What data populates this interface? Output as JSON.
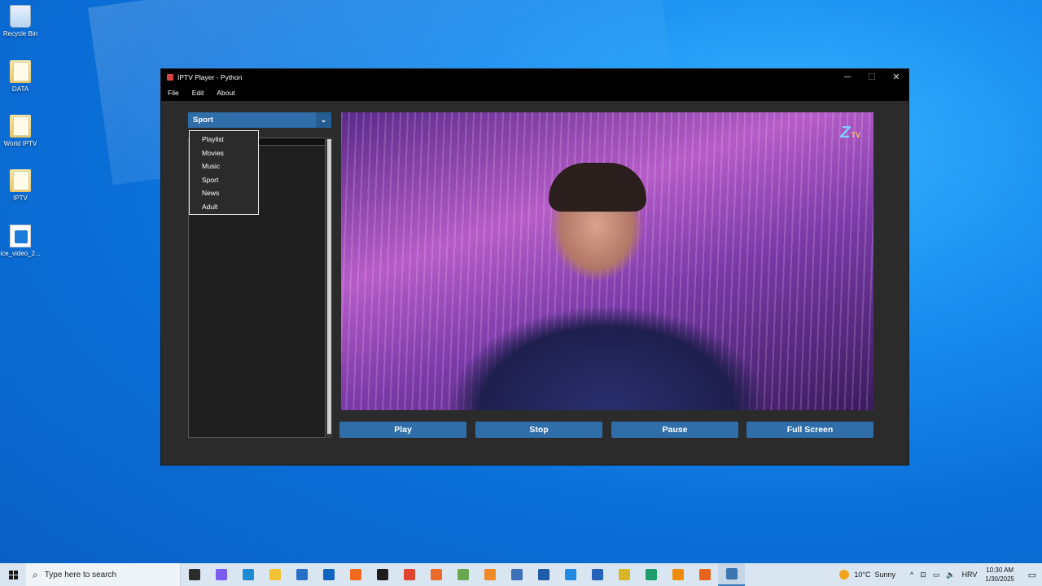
{
  "desktop": {
    "icons": [
      {
        "label": "Recycle Bin",
        "icon": "recycle-bin-icon"
      },
      {
        "label": "DATA",
        "icon": "folder-icon"
      },
      {
        "label": "World IPTV",
        "icon": "folder-icon"
      },
      {
        "label": "IPTV",
        "icon": "folder-icon"
      },
      {
        "label": "ice_video_2...",
        "icon": "video-file-icon"
      }
    ]
  },
  "window": {
    "title": "IPTV Player - Python",
    "controls": {
      "minimize": "─",
      "maximize": "☐",
      "close": "✕"
    },
    "menu": [
      "File",
      "Edit",
      "About"
    ],
    "category": {
      "selected": "Sport",
      "chevron": "⌄"
    },
    "dropdown_options": [
      "Playlist",
      "Movies",
      "Music",
      "Sport",
      "News",
      "Adult"
    ],
    "video": {
      "channel_logo": "TV",
      "logo_mark": "Z"
    },
    "buttons": {
      "play": "Play",
      "stop": "Stop",
      "pause": "Pause",
      "fullscreen": "Full Screen"
    }
  },
  "taskbar": {
    "search_placeholder": "Type here to search",
    "search_icon": "⌕",
    "pinned_apps": [
      {
        "name": "task-view",
        "color": "#2b2b2b"
      },
      {
        "name": "copilot",
        "color": "#7a5cf0"
      },
      {
        "name": "edge",
        "color": "#1e8ad6"
      },
      {
        "name": "file-explorer",
        "color": "#f1c232"
      },
      {
        "name": "microsoft-store",
        "color": "#2a6fc9"
      },
      {
        "name": "outlook",
        "color": "#0f64c0"
      },
      {
        "name": "firefox",
        "color": "#f06a1d"
      },
      {
        "name": "terminal",
        "color": "#1c1c1c"
      },
      {
        "name": "chrome",
        "color": "#e0452f"
      },
      {
        "name": "app-orange",
        "color": "#e86b2c"
      },
      {
        "name": "notepad-plus",
        "color": "#6aa84f"
      },
      {
        "name": "xampp",
        "color": "#f08a24"
      },
      {
        "name": "app-hex",
        "color": "#3d6fb6"
      },
      {
        "name": "app-blue-circle",
        "color": "#1e5ca8"
      },
      {
        "name": "vscode",
        "color": "#1f8ae0"
      },
      {
        "name": "app-list",
        "color": "#2463b8"
      },
      {
        "name": "app-yellow",
        "color": "#d9b52a"
      },
      {
        "name": "pycharm",
        "color": "#1e9c6a"
      },
      {
        "name": "vlc",
        "color": "#f08c00"
      },
      {
        "name": "app-orange-square",
        "color": "#e8641c"
      },
      {
        "name": "python",
        "color": "#3b77b0"
      }
    ],
    "weather": {
      "temp": "10°C",
      "condition": "Sunny"
    },
    "tray_icons": [
      "^",
      "⊡",
      "▭",
      "🔈"
    ],
    "language": "HRV",
    "time": "10:30 AM",
    "date": "1/30/2025",
    "notification_icon": "▭"
  }
}
